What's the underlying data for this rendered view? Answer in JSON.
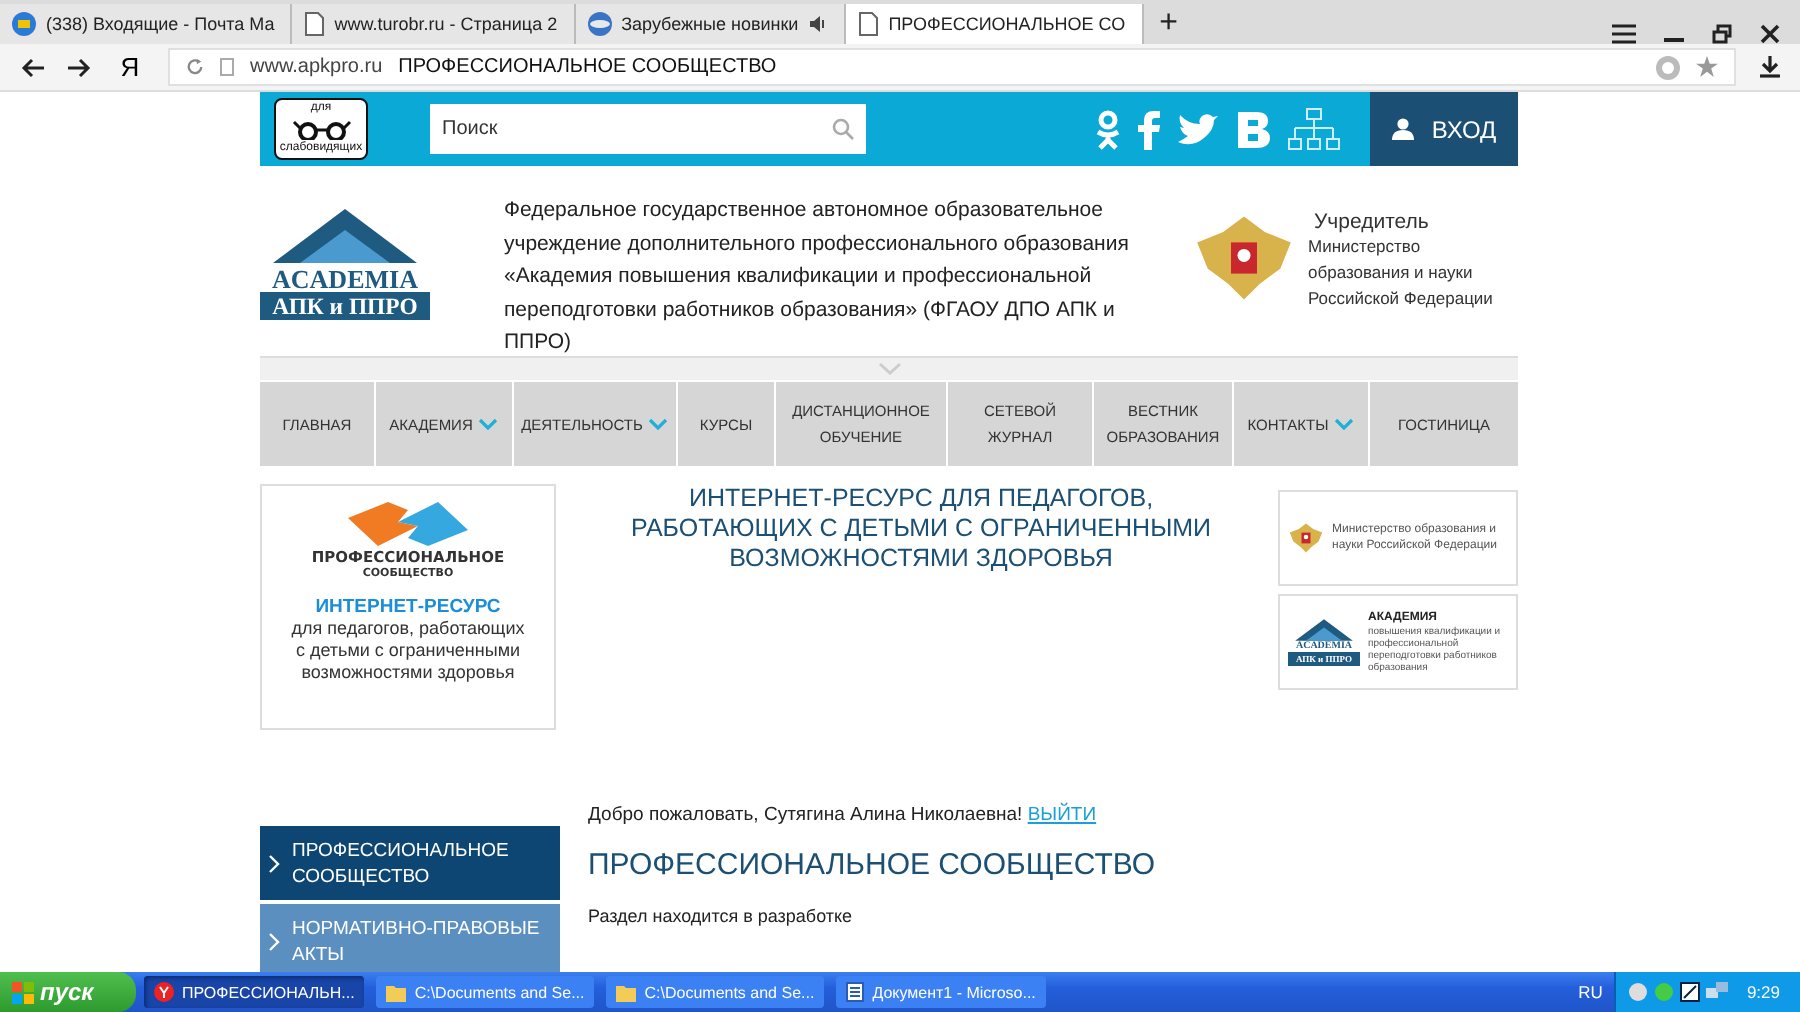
{
  "browser": {
    "tabs": [
      {
        "title": "(338) Входящие - Почта Ма",
        "selected": false,
        "audio": false
      },
      {
        "title": "www.turobr.ru - Страница 2",
        "selected": false,
        "audio": false
      },
      {
        "title": "Зарубежные новинки",
        "selected": false,
        "audio": true
      },
      {
        "title": "ПРОФЕССИОНАЛЬНОЕ СО",
        "selected": true,
        "audio": false
      }
    ],
    "new_tab": "+",
    "yandex_button": "Я",
    "address": {
      "url": "www.apkpro.ru",
      "page_title": "ПРОФЕССИОНАЛЬНОЕ СООБЩЕСТВО"
    }
  },
  "site_header": {
    "low_vision_label": "для слабовидящих",
    "search": {
      "placeholder": "Поиск"
    },
    "login": "ВХОД"
  },
  "organization": {
    "logo": {
      "line_1": "ACADEMIA",
      "line_2": "АПК и ППРО"
    },
    "description": "Федеральное государственное автономное образовательное учреждение дополнительного профессионального образования «Академия повышения квалификации и профессиональной переподготовки работников образования» (ФГАОУ ДПО АПК и ППРО)",
    "founder": {
      "title": "Учредитель",
      "name": "Министерство образования и науки Российской Федерации"
    }
  },
  "nav": [
    {
      "label": "ГЛАВНАЯ",
      "dropdown": false
    },
    {
      "label": "АКАДЕМИЯ",
      "dropdown": true
    },
    {
      "label": "ДЕЯТЕЛЬНОСТЬ",
      "dropdown": true
    },
    {
      "label": "КУРСЫ",
      "dropdown": false
    },
    {
      "label": "ДИСТАНЦИОННОЕ ОБУЧЕНИЕ",
      "dropdown": false
    },
    {
      "label": "СЕТЕВОЙ ЖУРНАЛ",
      "dropdown": false
    },
    {
      "label": "ВЕСТНИК ОБРАЗОВАНИЯ",
      "dropdown": false
    },
    {
      "label": "КОНТАКТЫ",
      "dropdown": true
    },
    {
      "label": "ГОСТИНИЦА",
      "dropdown": false
    }
  ],
  "banner": {
    "card": {
      "logo_line_1": "ПРОФЕССИОНАЛЬНОЕ",
      "logo_line_2": "СООБЩЕСТВО",
      "title": "ИНТЕРНЕТ-РЕСУРС",
      "text": "для педагогов, работающих с детьми с ограниченными возможностями здоровья"
    },
    "heading": "ИНТЕРНЕТ-РЕСУРС ДЛЯ ПЕДАГОГОВ, РАБОТАЮЩИХ С ДЕТЬМИ С ОГРАНИЧЕННЫМИ ВОЗМОЖНОСТЯМИ ЗДОРОВЬЯ",
    "partners": [
      {
        "kind": "ministry",
        "text": "Министерство образования и науки Российской Федерации"
      },
      {
        "kind": "academy",
        "title": "АКАДЕМИЯ",
        "text": "повышения квалификации и профессиональной переподготовки работников образования",
        "logo_line_1": "ACADEMIA",
        "logo_line_2": "АПК и ППРО"
      }
    ]
  },
  "sidebar": [
    {
      "label": "ПРОФЕССИОНАЛЬНОЕ СООБЩЕСТВО",
      "selected": true
    },
    {
      "label": "НОРМАТИВНО-ПРАВОВЫЕ АКТЫ",
      "selected": false
    }
  ],
  "content": {
    "welcome": "Добро пожаловать, Сутягина Алина Николаевна!",
    "logout_link": "ВЫЙТИ",
    "heading": "ПРОФЕССИОНАЛЬНОЕ СООБЩЕСТВО",
    "text": "Раздел находится в разработке"
  },
  "taskbar": {
    "start": "пуск",
    "items": [
      {
        "label": "ПРОФЕССИОНАЛЬН...",
        "selected": true,
        "kind": "browser"
      },
      {
        "label": "C:\\Documents and Se...",
        "selected": false,
        "kind": "folder"
      },
      {
        "label": "C:\\Documents and Se...",
        "selected": false,
        "kind": "folder"
      },
      {
        "label": "Документ1 - Microso...",
        "selected": false,
        "kind": "document"
      }
    ],
    "language": "RU",
    "time": "9:29"
  }
}
